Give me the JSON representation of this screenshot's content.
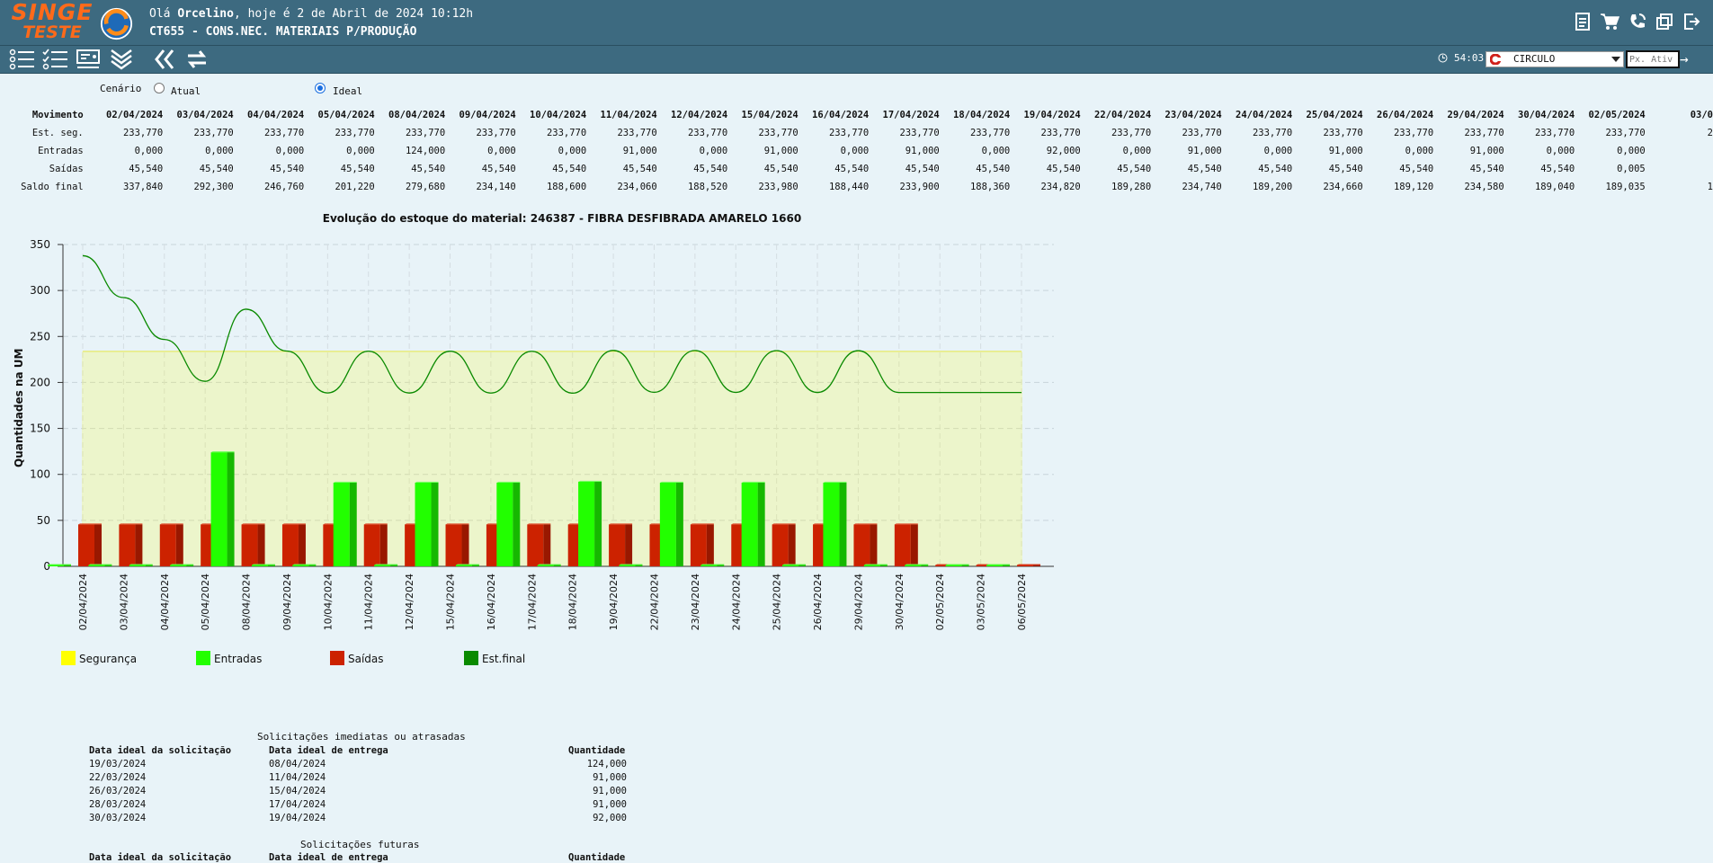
{
  "header": {
    "logo_line1": "SINGE",
    "logo_line2": "TESTE",
    "greeting_prefix": "Olá ",
    "user": "Orcelino",
    "greeting_suffix": ", hoje é 2 de Abril de 2024 10:12h",
    "screen_title": "CT655 - CONS.NEC. MATERIAIS P/PRODUÇÃO",
    "icons": [
      "document-icon",
      "cart-icon",
      "phone-icon",
      "windows-icon",
      "logout-icon"
    ]
  },
  "toolbar": {
    "icons": [
      "list-filter-icon",
      "checklist-icon",
      "screen-options-icon",
      "expand-down-icon",
      "back-icon",
      "refresh-icon"
    ],
    "timer": "54:03",
    "company": "CIRCULO",
    "px_placeholder": "Px. Ativ",
    "go_icon": "arrow-right-icon"
  },
  "cenario": {
    "label": "Cenário",
    "options": [
      {
        "label": "Atual",
        "selected": false
      },
      {
        "label": "Ideal",
        "selected": true
      }
    ]
  },
  "movimento": {
    "header_label": "Movimento",
    "dates": [
      "02/04/2024",
      "03/04/2024",
      "04/04/2024",
      "05/04/2024",
      "08/04/2024",
      "09/04/2024",
      "10/04/2024",
      "11/04/2024",
      "12/04/2024",
      "15/04/2024",
      "16/04/2024",
      "17/04/2024",
      "18/04/2024",
      "19/04/2024",
      "22/04/2024",
      "23/04/2024",
      "24/04/2024",
      "25/04/2024",
      "26/04/2024",
      "29/04/2024",
      "30/04/2024",
      "02/05/2024",
      "03/0"
    ],
    "rows": [
      {
        "label": "Est. seg.",
        "values": [
          "233,770",
          "233,770",
          "233,770",
          "233,770",
          "233,770",
          "233,770",
          "233,770",
          "233,770",
          "233,770",
          "233,770",
          "233,770",
          "233,770",
          "233,770",
          "233,770",
          "233,770",
          "233,770",
          "233,770",
          "233,770",
          "233,770",
          "233,770",
          "233,770",
          "233,770",
          "2"
        ]
      },
      {
        "label": "Entradas",
        "values": [
          "0,000",
          "0,000",
          "0,000",
          "0,000",
          "124,000",
          "0,000",
          "0,000",
          "91,000",
          "0,000",
          "91,000",
          "0,000",
          "91,000",
          "0,000",
          "92,000",
          "0,000",
          "91,000",
          "0,000",
          "91,000",
          "0,000",
          "91,000",
          "0,000",
          "0,000",
          ""
        ]
      },
      {
        "label": "Saídas",
        "values": [
          "45,540",
          "45,540",
          "45,540",
          "45,540",
          "45,540",
          "45,540",
          "45,540",
          "45,540",
          "45,540",
          "45,540",
          "45,540",
          "45,540",
          "45,540",
          "45,540",
          "45,540",
          "45,540",
          "45,540",
          "45,540",
          "45,540",
          "45,540",
          "45,540",
          "0,005",
          ""
        ]
      },
      {
        "label": "Saldo final",
        "values": [
          "337,840",
          "292,300",
          "246,760",
          "201,220",
          "279,680",
          "234,140",
          "188,600",
          "234,060",
          "188,520",
          "233,980",
          "188,440",
          "233,900",
          "188,360",
          "234,820",
          "189,280",
          "234,740",
          "189,200",
          "234,660",
          "189,120",
          "234,580",
          "189,040",
          "189,035",
          "1"
        ]
      }
    ]
  },
  "chart_data": {
    "type": "bar",
    "title": "Evolução do estoque do material: 246387 - FIBRA DESFIBRADA AMARELO 1660",
    "ylabel": "Quantidades na UM",
    "xlabel": "",
    "ylim": [
      0,
      350
    ],
    "yticks": [
      0,
      50,
      100,
      150,
      200,
      250,
      300,
      350
    ],
    "grid": true,
    "legend_position": "bottom",
    "categories": [
      "02/04/2024",
      "03/04/2024",
      "04/04/2024",
      "05/04/2024",
      "08/04/2024",
      "09/04/2024",
      "10/04/2024",
      "11/04/2024",
      "12/04/2024",
      "15/04/2024",
      "16/04/2024",
      "17/04/2024",
      "18/04/2024",
      "19/04/2024",
      "22/04/2024",
      "23/04/2024",
      "24/04/2024",
      "25/04/2024",
      "26/04/2024",
      "29/04/2024",
      "30/04/2024",
      "02/05/2024",
      "03/05/2024",
      "06/05/2024"
    ],
    "series": [
      {
        "name": "Segurança",
        "kind": "area",
        "color": "#ffff00",
        "values": [
          233.77,
          233.77,
          233.77,
          233.77,
          233.77,
          233.77,
          233.77,
          233.77,
          233.77,
          233.77,
          233.77,
          233.77,
          233.77,
          233.77,
          233.77,
          233.77,
          233.77,
          233.77,
          233.77,
          233.77,
          233.77,
          233.77,
          233.77,
          233.77
        ]
      },
      {
        "name": "Entradas",
        "kind": "bar",
        "color": "#22ff00",
        "values": [
          0,
          0,
          0,
          0,
          124,
          0,
          0,
          91,
          0,
          91,
          0,
          91,
          0,
          92,
          0,
          91,
          0,
          91,
          0,
          91,
          0,
          0,
          0,
          0
        ]
      },
      {
        "name": "Saídas",
        "kind": "bar",
        "color": "#cc2200",
        "values": [
          45.54,
          45.54,
          45.54,
          45.54,
          45.54,
          45.54,
          45.54,
          45.54,
          45.54,
          45.54,
          45.54,
          45.54,
          45.54,
          45.54,
          45.54,
          45.54,
          45.54,
          45.54,
          45.54,
          45.54,
          45.54,
          0.005,
          0,
          0
        ]
      },
      {
        "name": "Est.final",
        "kind": "line",
        "color": "#0a8a00",
        "values": [
          337.84,
          292.3,
          246.76,
          201.22,
          279.68,
          234.14,
          188.6,
          234.06,
          188.52,
          233.98,
          188.44,
          233.9,
          188.36,
          234.82,
          189.28,
          234.74,
          189.2,
          234.66,
          189.12,
          234.58,
          189.04,
          189.035,
          189.03,
          189.03
        ]
      }
    ]
  },
  "solicitacoes": {
    "imediatas": {
      "title": "Solicitações imediatas ou atrasadas",
      "headers": [
        "Data ideal da solicitação",
        "Data ideal de entrega",
        "Quantidade"
      ],
      "rows": [
        [
          "19/03/2024",
          "08/04/2024",
          "124,000"
        ],
        [
          "22/03/2024",
          "11/04/2024",
          "91,000"
        ],
        [
          "26/03/2024",
          "15/04/2024",
          "91,000"
        ],
        [
          "28/03/2024",
          "17/04/2024",
          "91,000"
        ],
        [
          "30/03/2024",
          "19/04/2024",
          "92,000"
        ]
      ]
    },
    "futuras": {
      "title": "Solicitações futuras",
      "headers": [
        "Data ideal da solicitação",
        "Data ideal de entrega",
        "Quantidade"
      ]
    }
  }
}
